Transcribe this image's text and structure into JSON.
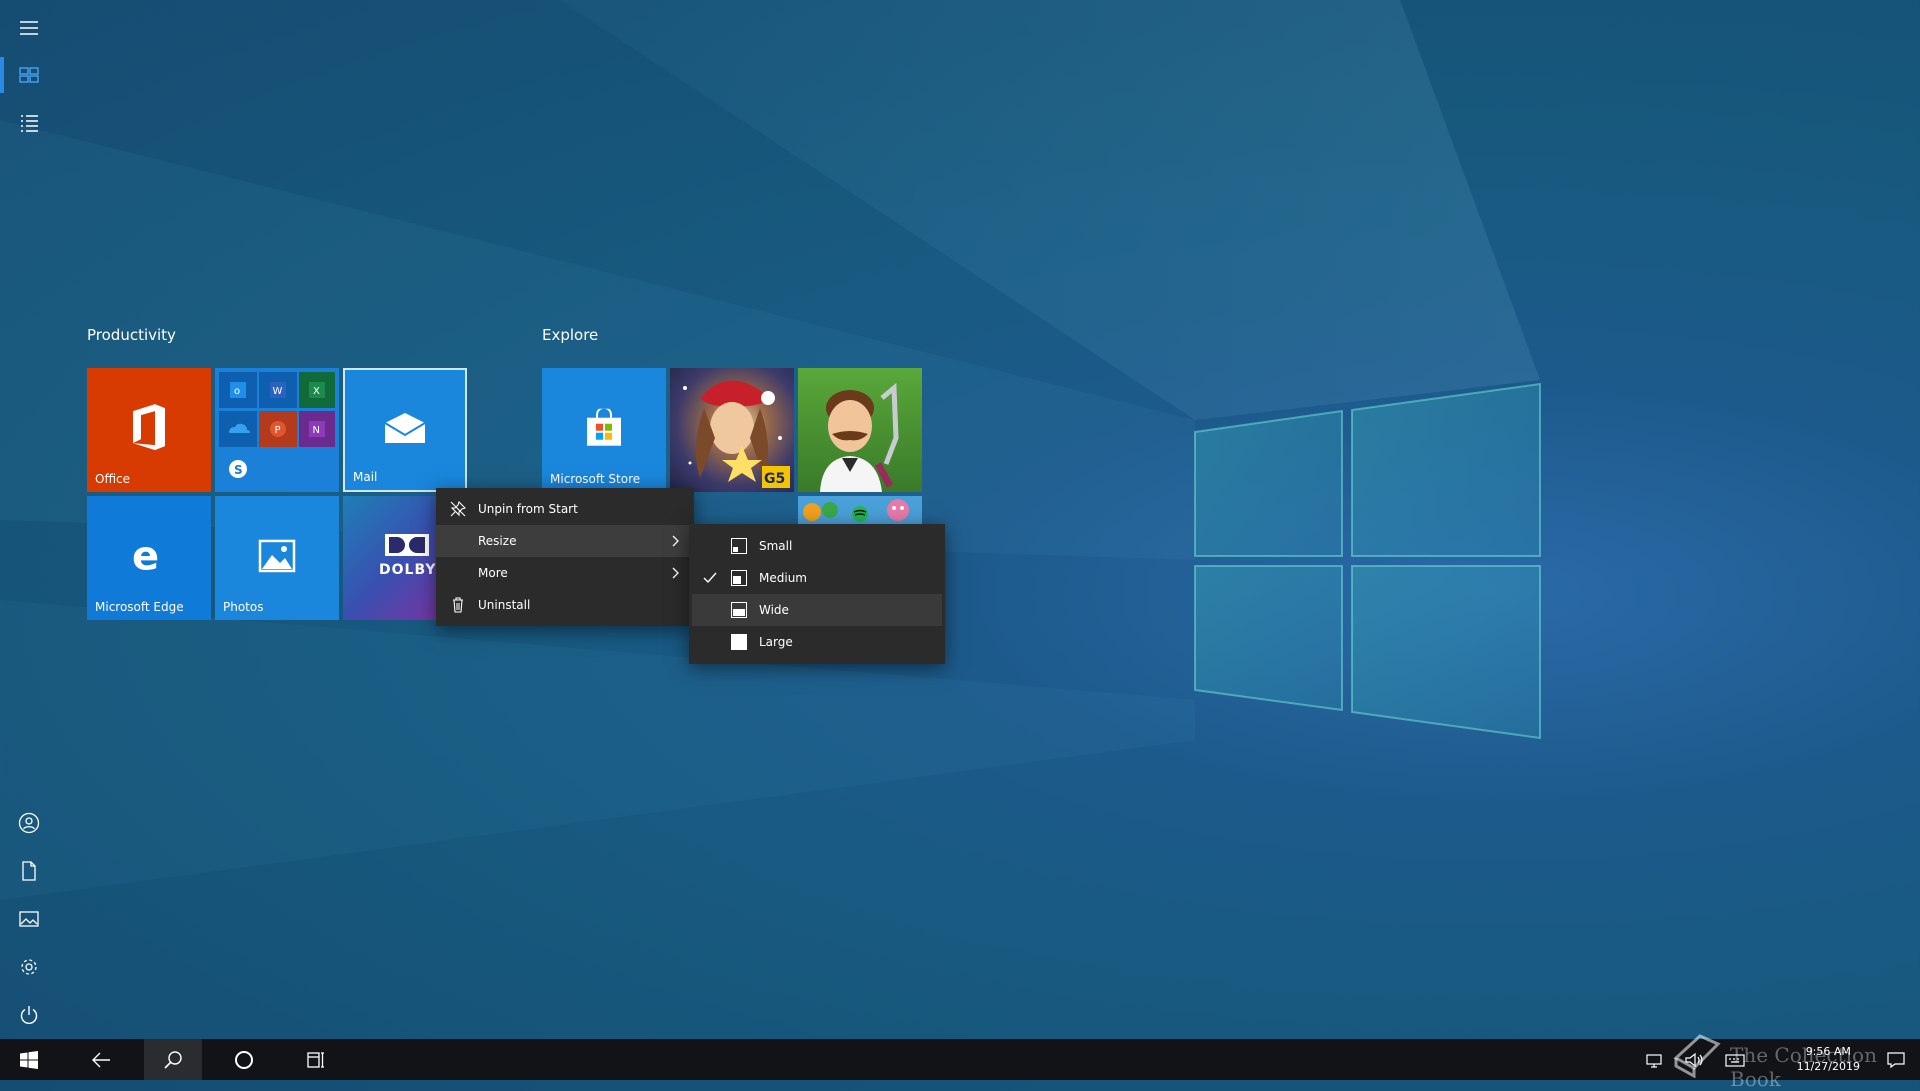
{
  "groups": {
    "productivity": "Productivity",
    "explore": "Explore"
  },
  "tiles": {
    "office": "Office",
    "mail": "Mail",
    "edge": "Microsoft Edge",
    "photos": "Photos",
    "dolby": "DOLBY",
    "store": "Microsoft Store"
  },
  "context_menu": {
    "unpin": "Unpin from Start",
    "resize": "Resize",
    "more": "More",
    "uninstall": "Uninstall"
  },
  "resize_menu": {
    "small": "Small",
    "medium": "Medium",
    "wide": "Wide",
    "large": "Large",
    "checked": "Medium"
  },
  "clock": {
    "time": "9:56 AM",
    "date": "11/27/2019"
  },
  "watermark": "The Collection Book",
  "colors": {
    "office": "#d83b01",
    "tile_blue": "#0078d7",
    "menu_bg": "#2b2b2b",
    "taskbar": "#111316",
    "accent": "#2b8ae6"
  }
}
